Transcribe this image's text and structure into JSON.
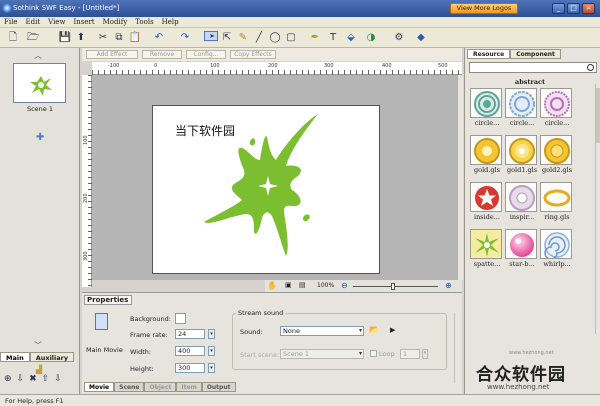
{
  "titlebar": {
    "title": "Sothink SWF Easy - [Untitled*]",
    "logos_button": "View More Logos",
    "minimize": "_",
    "maximize": "□",
    "close": "×"
  },
  "menu": [
    "File",
    "Edit",
    "View",
    "Insert",
    "Modify",
    "Tools",
    "Help"
  ],
  "effects": {
    "add": "Add Effect",
    "remove": "Remove",
    "config": "Config...",
    "copy": "Copy Effects"
  },
  "ruler_top": [
    "-100",
    "0",
    "100",
    "200",
    "300",
    "400",
    "500"
  ],
  "ruler_left": [
    "100",
    "200",
    "300"
  ],
  "scenes": {
    "label": "Scene 1"
  },
  "left_tabs": {
    "main": "Main",
    "auxiliary": "Auxiliary"
  },
  "stage": {
    "text": "当下软件园"
  },
  "zoom": {
    "value": "100%"
  },
  "resource": {
    "tabs": {
      "resource": "Resource",
      "component": "Component"
    },
    "search_value": "",
    "heading": "abstract",
    "items": [
      {
        "label": "circle..."
      },
      {
        "label": "circle..."
      },
      {
        "label": "circle..."
      },
      {
        "label": "gold.gls"
      },
      {
        "label": "gold1.gls"
      },
      {
        "label": "gold2.gls"
      },
      {
        "label": "inside..."
      },
      {
        "label": "inspir..."
      },
      {
        "label": "ring.gls"
      },
      {
        "label": "spatte..."
      },
      {
        "label": "star-b..."
      },
      {
        "label": "whirlp..."
      }
    ]
  },
  "properties": {
    "title": "Properties",
    "movie_label": "Main Movie",
    "background_label": "Background:",
    "frame_rate_label": "Frame rate:",
    "frame_rate": "24",
    "width_label": "Width:",
    "width": "400",
    "height_label": "Height:",
    "height": "300",
    "stream_title": "Stream sound",
    "sound_label": "Sound:",
    "sound_value": "None",
    "start_scene_label": "Start scene:",
    "start_scene_value": "Scene 1",
    "loop_label": "Loop",
    "loop_value": "1",
    "tabs": [
      "Movie",
      "Scene",
      "Object",
      "Item",
      "Output"
    ]
  },
  "status": "For Help, press F1",
  "watermark": {
    "text": "合众软件园",
    "url": "www.hezhong.net",
    "logo": "www.hezhong.net"
  }
}
